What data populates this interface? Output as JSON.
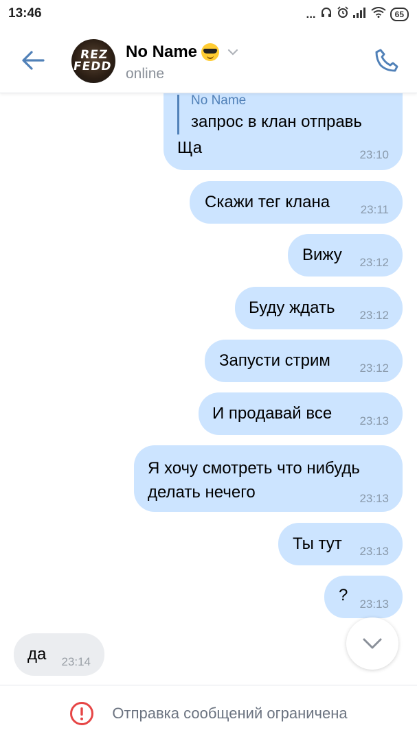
{
  "status_bar": {
    "time": "13:46",
    "signal_dots": "...",
    "battery": "65"
  },
  "header": {
    "contact_name": "No Name",
    "contact_status": "online",
    "avatar_text_line1": "REZ",
    "avatar_text_line2": "FEDD",
    "icons": {
      "back": "arrow-left-icon",
      "emoji": "sunglasses-emoji",
      "chevron": "chevron-down-icon",
      "call": "phone-icon"
    }
  },
  "messages": [
    {
      "direction": "out",
      "reply_to": {
        "name": "No Name",
        "text": "запрос в клан отправь"
      },
      "text": "Ща",
      "time": "23:10"
    },
    {
      "direction": "out",
      "text": "Скажи тег клана",
      "time": "23:11"
    },
    {
      "direction": "out",
      "text": "Вижу",
      "time": "23:12"
    },
    {
      "direction": "out",
      "text": "Буду ждать",
      "time": "23:12"
    },
    {
      "direction": "out",
      "text": "Запусти стрим",
      "time": "23:12"
    },
    {
      "direction": "out",
      "text": "И продавай все",
      "time": "23:13"
    },
    {
      "direction": "out",
      "text_line1": "Я хочу смотреть что нибудь",
      "text_line2": "делать нечего",
      "time": "23:13"
    },
    {
      "direction": "out",
      "text": "Ты тут",
      "time": "23:13"
    },
    {
      "direction": "out",
      "text": "?",
      "time": "23:13"
    },
    {
      "direction": "in",
      "text": "да",
      "time": "23:14"
    }
  ],
  "footer": {
    "notice": "Отправка сообщений ограничена",
    "icon": "exclamation-circle-icon"
  },
  "colors": {
    "accent": "#5181b8",
    "outgoing_bubble": "#cce4ff",
    "incoming_bubble": "#ebedf0",
    "warning": "#e64646"
  }
}
